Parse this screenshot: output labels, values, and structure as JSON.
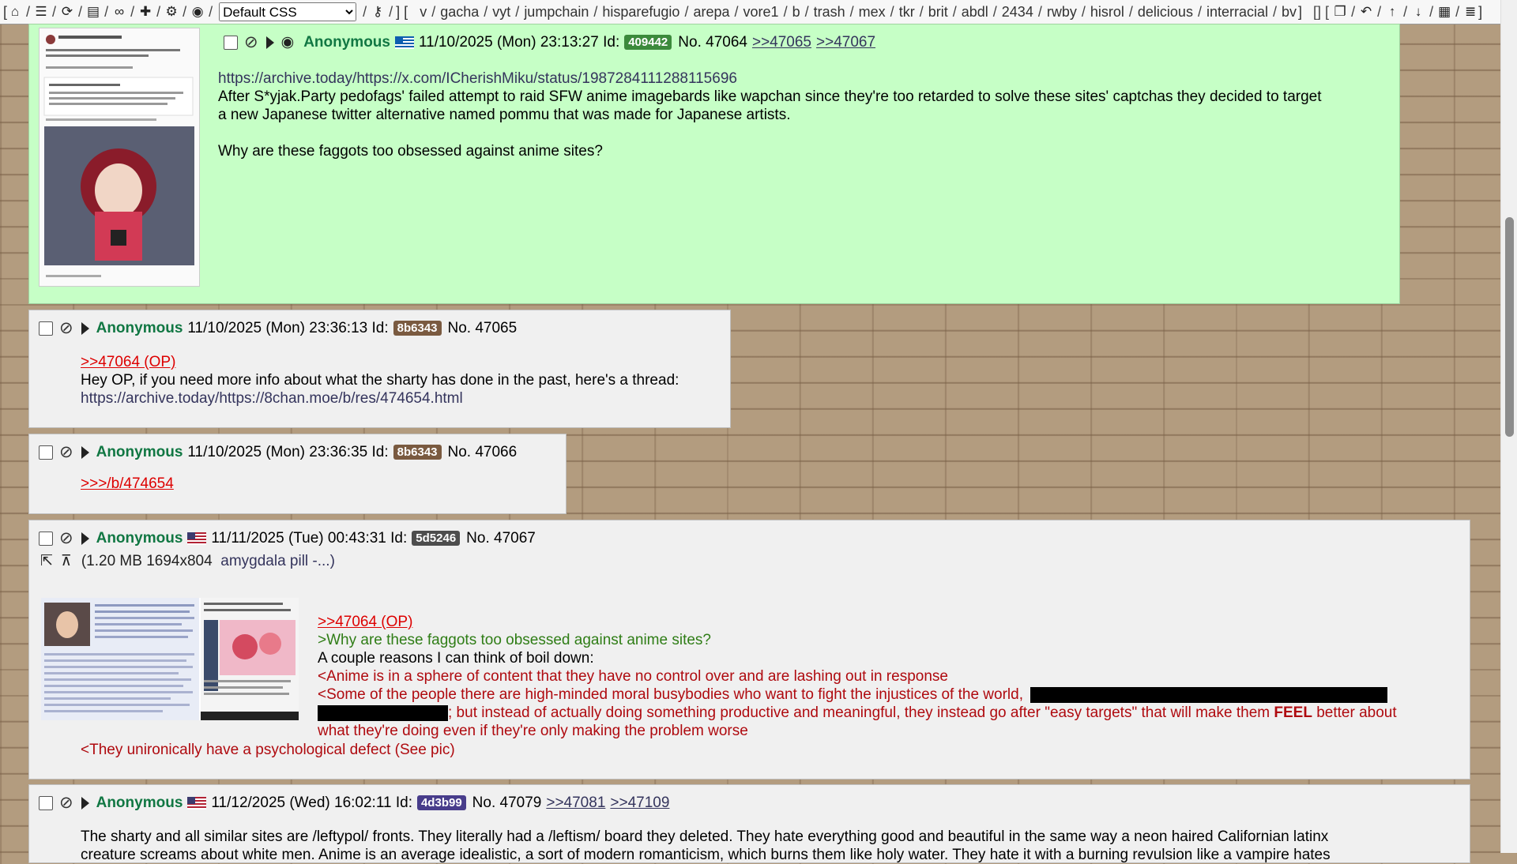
{
  "topbar": {
    "style_select": "Default CSS",
    "boards": [
      "v",
      "gacha",
      "vyt",
      "jumpchain",
      "hisparefugio",
      "arepa",
      "vore1",
      "b",
      "trash",
      "mex",
      "tkr",
      "brit",
      "abdl",
      "2434",
      "rwby",
      "hisrol",
      "delicious",
      "interracial",
      "bv"
    ]
  },
  "posts": [
    {
      "name": "Anonymous",
      "date": "11/10/2025 (Mon) 23:13:27",
      "id_label": "Id:",
      "id": "409442",
      "id_color": "#3c8a3c",
      "no": "No. 47064",
      "backlinks": [
        ">>47065",
        ">>47067"
      ],
      "lines": [
        "https://archive.today/https://x.com/ICherishMiku/status/1987284111288115696",
        "After S*yjak.Party pedofags' failed attempt to raid SFW anime imagebards like wapchan since they're too retarded to solve these sites' captchas they decided to target",
        "a new Japanese twitter alternative named pommu that was made for Japanese artists.",
        "Why are these faggots too obsessed against anime sites?"
      ]
    },
    {
      "name": "Anonymous",
      "date": "11/10/2025 (Mon) 23:36:13",
      "id_label": "Id:",
      "id": "8b6343",
      "id_color": "#7a5a40",
      "no": "No. 47065",
      "reply": ">>47064 (OP)",
      "lines": [
        "Hey OP, if you need more info about what the sharty has done in the past, here's a thread:",
        "https://archive.today/https://8chan.moe/b/res/474654.html"
      ]
    },
    {
      "name": "Anonymous",
      "date": "11/10/2025 (Mon) 23:36:35",
      "id_label": "Id:",
      "id": "8b6343",
      "id_color": "#7a5a40",
      "no": "No. 47066",
      "reply": ">>>/b/474654"
    },
    {
      "name": "Anonymous",
      "date": "11/11/2025 (Tue) 00:43:31",
      "id_label": "Id:",
      "id": "5d5246",
      "id_color": "#4d4d4d",
      "no": "No. 47067",
      "file_info": "(1.20 MB  1694x804",
      "file_name": "amygdala pill -...)",
      "reply": ">>47064 (OP)",
      "quote": ">Why are these faggots too obsessed against anime sites?",
      "plain": "A couple reasons I can think of boil down:",
      "red1": "<Anime is in a sphere of content that they have no control over and are lashing out in response",
      "red2": "<Some of the people there are high-minded moral busybodies who want to fight the injustices of the world,",
      "red3a": "; but instead of actually doing something productive and meaningful, they instead go after \"easy targets\" that will make them",
      "red3b": "FEEL",
      "red3c": "better about",
      "red4": "what they're doing even if they're only making the problem worse",
      "red5": "<They unironically have a psychological defect (See pic)"
    },
    {
      "name": "Anonymous",
      "date": "11/12/2025 (Wed) 16:02:11",
      "id_label": "Id:",
      "id": "4d3b99",
      "id_color": "#483d8b",
      "no": "No. 47079",
      "backlinks": [
        ">>47081",
        ">>47109"
      ],
      "lines": [
        "The sharty and all similar sites are /leftypol/ fronts.  They literally had a /leftism/ board they deleted.   They hate everything good and beautiful in the same way a neon haired Californian latinx",
        "creature screams about white men.  Anime is an average idealistic, a sort of modern romanticism, which burns them like holy water. They hate it with a burning revulsion like a vampire hates"
      ]
    }
  ]
}
